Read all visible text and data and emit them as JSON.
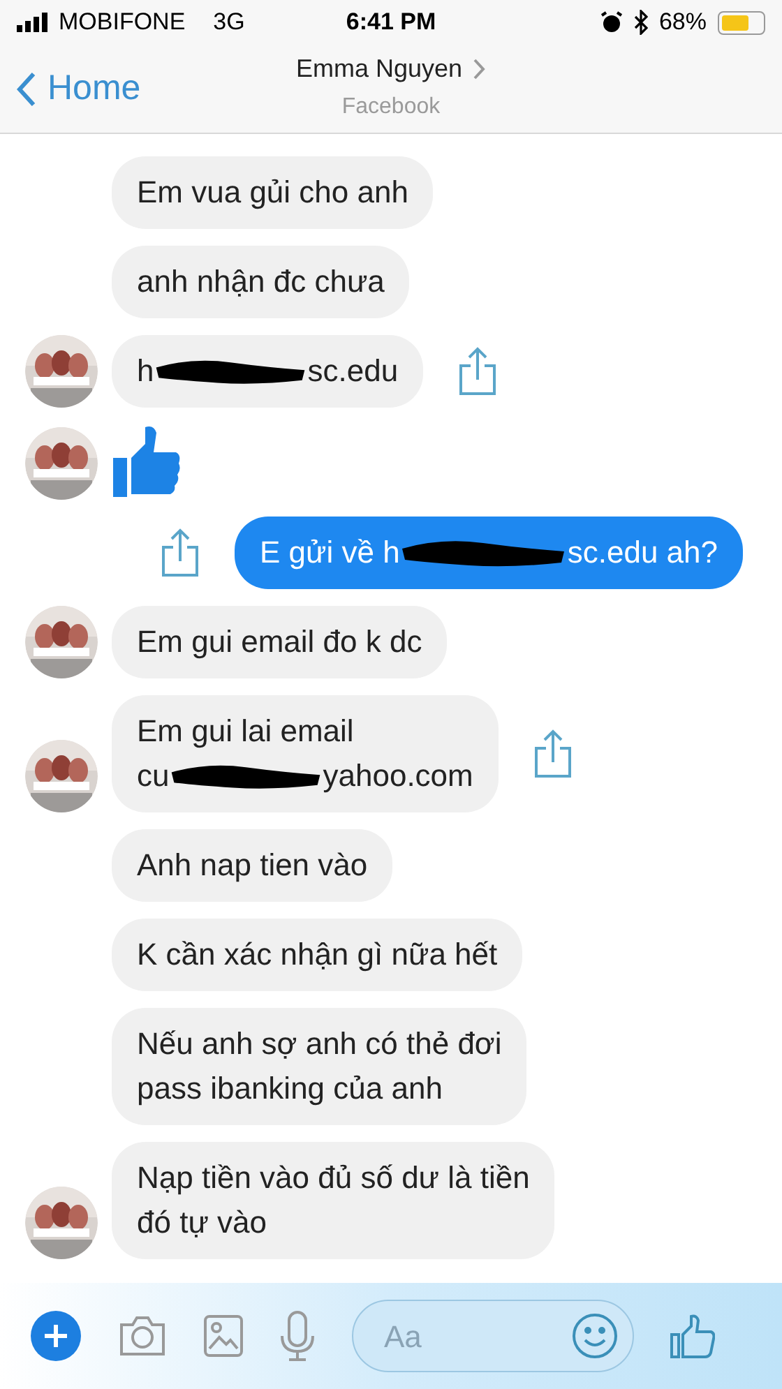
{
  "status_bar": {
    "carrier": "MOBIFONE",
    "network": "3G",
    "time": "6:41 PM",
    "battery": "68%"
  },
  "header": {
    "back": "Home",
    "name": "Emma Nguyen",
    "subtitle": "Facebook"
  },
  "messages": [
    {
      "kind": "incoming",
      "avatar": false,
      "share": false,
      "lines": [
        [
          {
            "kind": "text",
            "text": "Em vua gủi cho anh"
          }
        ]
      ]
    },
    {
      "kind": "incoming",
      "avatar": false,
      "share": false,
      "lines": [
        [
          {
            "kind": "text",
            "text": "anh nhận đc chưa"
          }
        ]
      ]
    },
    {
      "kind": "incoming",
      "avatar": true,
      "share": true,
      "lines": [
        [
          {
            "kind": "text",
            "text": "h"
          },
          {
            "kind": "redaction"
          },
          {
            "kind": "text",
            "text": "sc.edu"
          }
        ]
      ]
    },
    {
      "kind": "incoming_like",
      "avatar": true,
      "share": false
    },
    {
      "kind": "outgoing",
      "share": true,
      "lines": [
        [
          {
            "kind": "text",
            "text": "E gửi về h"
          },
          {
            "kind": "redaction"
          },
          {
            "kind": "text",
            "text": "sc.edu ah?"
          }
        ]
      ]
    },
    {
      "kind": "incoming",
      "avatar": true,
      "share": false,
      "lines": [
        [
          {
            "kind": "text",
            "text": "Em gui email đo k dc"
          }
        ]
      ]
    },
    {
      "kind": "incoming",
      "avatar": true,
      "share": true,
      "lines": [
        [
          {
            "kind": "text",
            "text": "Em gui lai email"
          }
        ],
        [
          {
            "kind": "text",
            "text": "cu"
          },
          {
            "kind": "redaction"
          },
          {
            "kind": "text",
            "text": "yahoo.com"
          }
        ]
      ]
    },
    {
      "kind": "incoming",
      "avatar": false,
      "share": false,
      "lines": [
        [
          {
            "kind": "text",
            "text": "Anh nap tien vào"
          }
        ]
      ]
    },
    {
      "kind": "incoming",
      "avatar": false,
      "share": false,
      "lines": [
        [
          {
            "kind": "text",
            "text": "K cần xác nhận gì nữa hết"
          }
        ]
      ]
    },
    {
      "kind": "incoming",
      "avatar": false,
      "share": false,
      "lines": [
        [
          {
            "kind": "text",
            "text": "Nếu anh sợ anh có thẻ đơi"
          }
        ],
        [
          {
            "kind": "text",
            "text": "pass ibanking của anh"
          }
        ]
      ]
    },
    {
      "kind": "incoming",
      "avatar": true,
      "share": false,
      "lines": [
        [
          {
            "kind": "text",
            "text": "Nạp tiền vào đủ số dư là tiền"
          }
        ],
        [
          {
            "kind": "text",
            "text": "đó tự vào"
          }
        ]
      ]
    }
  ],
  "composer": {
    "placeholder": "Aa"
  }
}
